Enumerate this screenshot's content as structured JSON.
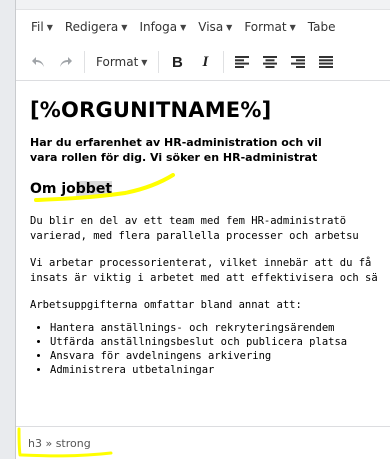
{
  "menubar": {
    "items": [
      {
        "label": "Fil"
      },
      {
        "label": "Redigera"
      },
      {
        "label": "Infoga"
      },
      {
        "label": "Visa"
      },
      {
        "label": "Format"
      },
      {
        "label": "Tabe"
      }
    ]
  },
  "toolbar": {
    "undo_icon": "undo-icon",
    "redo_icon": "redo-icon",
    "format_label": "Format",
    "bold_label": "B",
    "italic_label": "I",
    "align_icons": [
      "align-left-icon",
      "align-center-icon",
      "align-right-icon",
      "align-justify-icon"
    ]
  },
  "content": {
    "heading": "[%ORGUNITNAME%]",
    "lead_line1": "Har du erfarenhet av HR-administration och vil",
    "lead_line2": "vara rollen för dig. Vi söker en HR-administrat",
    "subheading_prefix": "Om jo",
    "subheading_highlight": "bbet",
    "para1_line1": "Du blir en del av ett team med fem HR-administratö",
    "para1_line2": "varierad, med flera parallella processer och arbetsu",
    "para2_line1": "Vi arbetar processorienterat, vilket innebär att du få",
    "para2_line2": "insats är viktig i arbetet med att effektivisera och sä",
    "para3": "Arbetsuppgifterna omfattar bland annat att:",
    "bullets": [
      "Hantera anställnings- och rekryteringsärendem",
      "Utfärda anställningsbeslut och publicera platsa",
      "Ansvara för avdelningens arkivering",
      "Administrera utbetalningar"
    ]
  },
  "statusbar": {
    "path": "h3 » strong"
  },
  "colors": {
    "highlighter": "#ffff00",
    "selection": "#d9d9d9"
  }
}
